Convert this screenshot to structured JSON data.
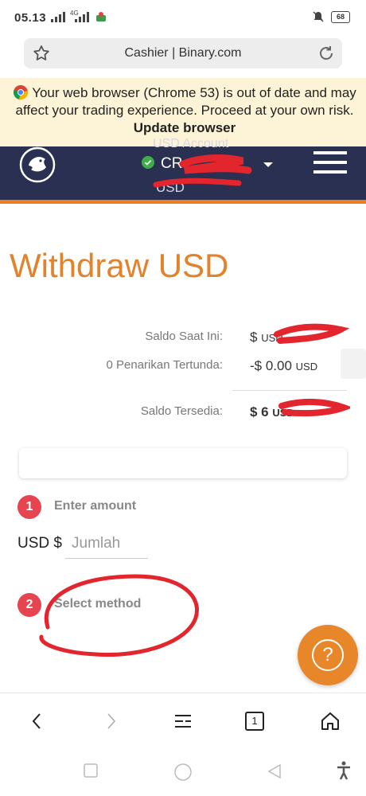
{
  "status_bar": {
    "time": "05.13",
    "network_label": "4G",
    "battery": "68"
  },
  "address_bar": {
    "title": "Cashier | Binary.com"
  },
  "warning": {
    "text": "Your web browser (Chrome 53) is out of date and may affect your trading experience. Proceed at your own risk.",
    "link": "Update browser"
  },
  "header": {
    "account_type": "USD Account",
    "account_id": "CR",
    "balance": "USD"
  },
  "page": {
    "title": "Withdraw USD",
    "summary": [
      {
        "label": "Saldo Saat Ini:",
        "value": "$",
        "currency": "USD"
      },
      {
        "label": "0 Penarikan Tertunda:",
        "value": "-$ 0.00",
        "currency": "USD"
      },
      {
        "label": "Saldo Tersedia:",
        "value": "$ 6",
        "currency": "USD"
      }
    ],
    "steps": [
      {
        "number": "1",
        "label": "Enter amount"
      },
      {
        "number": "2",
        "label": "Select method"
      }
    ],
    "currency_label": "USD $",
    "amount_placeholder": "Jumlah",
    "help_glyph": "?"
  },
  "toolbar": {
    "tabs_count": "1"
  },
  "colors": {
    "header_bg": "#2a3052",
    "accent_orange": "#e2822c",
    "step_red": "#e6454f",
    "annotation_red": "#e3262e"
  },
  "icons": [
    "star-icon",
    "reload-icon",
    "chrome-icon",
    "check-icon",
    "menu-icon",
    "help-icon",
    "back-icon",
    "forward-icon",
    "tabs-icon",
    "home-icon"
  ]
}
